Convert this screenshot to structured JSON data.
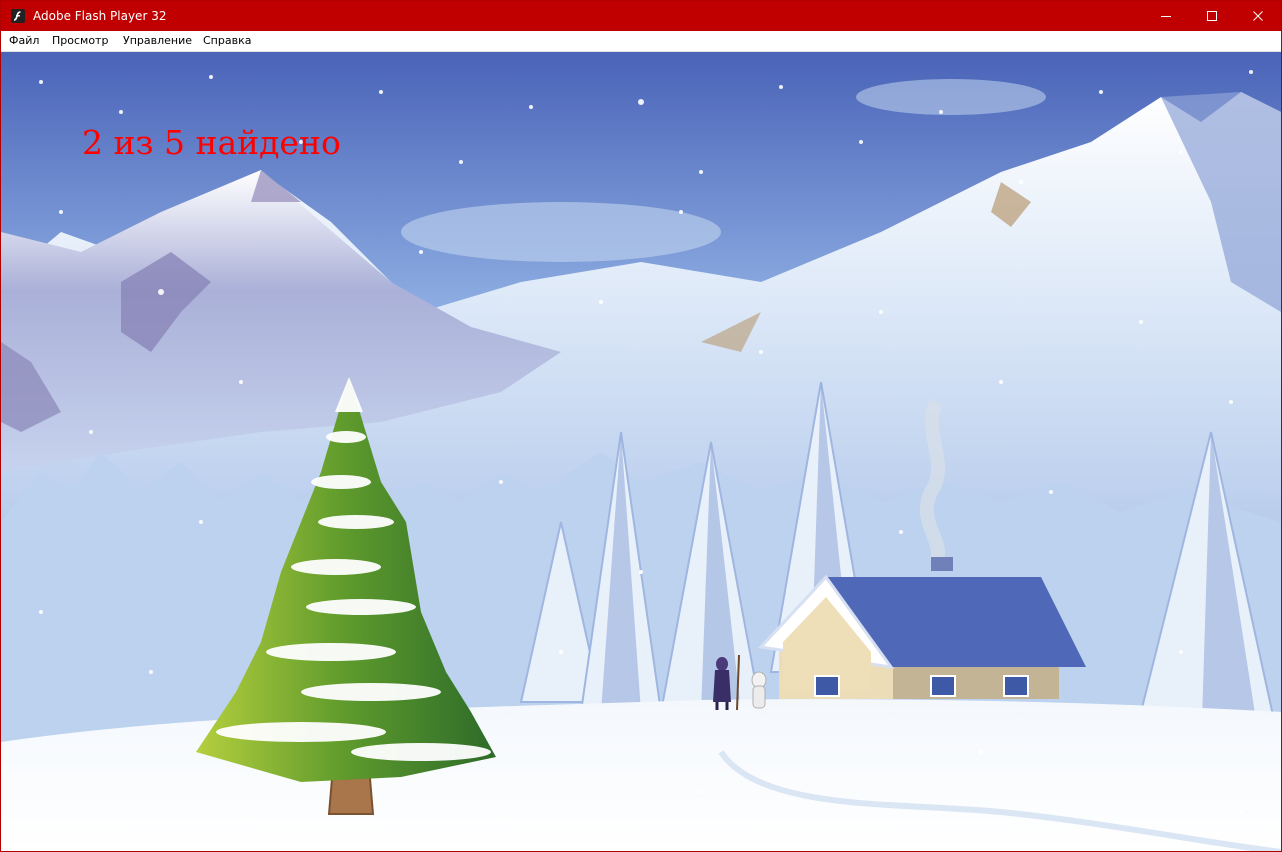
{
  "window": {
    "title": "Adobe Flash Player 32",
    "accent_color": "#c00000",
    "icon": "flash-player-icon"
  },
  "menu": {
    "file": "Файл",
    "view": "Просмотр",
    "control": "Управление",
    "help": "Справка"
  },
  "game": {
    "counter_text": "2 из 5 найдено",
    "counter_color": "#ff0000",
    "found": 2,
    "total": 5
  }
}
